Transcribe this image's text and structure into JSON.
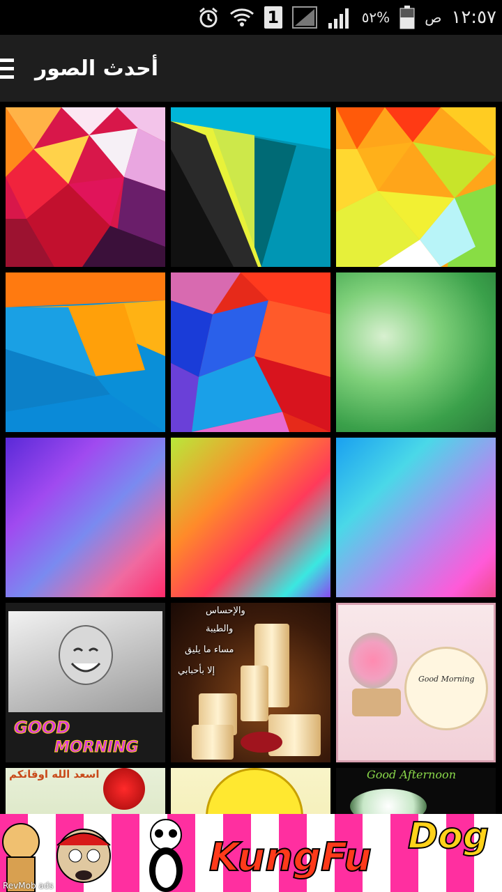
{
  "status_bar": {
    "time": "١٢:٥٧",
    "am_pm": "ص",
    "battery": "٥٢%",
    "sim": "1"
  },
  "app_bar": {
    "title": "أحدث الصور"
  },
  "tiles": [
    {
      "name": "poly-red-pink"
    },
    {
      "name": "material-yellow-teal"
    },
    {
      "name": "poly-orange-green"
    },
    {
      "name": "material-orange-blue"
    },
    {
      "name": "poly-blue-red"
    },
    {
      "name": "blur-green"
    },
    {
      "name": "blur-purple-pink"
    },
    {
      "name": "blur-green-orange"
    },
    {
      "name": "blur-blue-pink"
    },
    {
      "name": "good-morning-baby",
      "text1": "GOOD",
      "text2": "MORNING"
    },
    {
      "name": "candles-arabic",
      "lines": [
        "والإحساس",
        "والطيبة",
        "مساء ما يليق",
        "إلا بأحبابي"
      ]
    },
    {
      "name": "good-morning-clock",
      "text": "Good Morning"
    },
    {
      "name": "arabic-rose",
      "text": "اسعد الله اوقاتكم"
    },
    {
      "name": "yellow-smiley"
    },
    {
      "name": "good-afternoon",
      "text": "Good Afternoon"
    }
  ],
  "ad": {
    "title1": "KungFu",
    "title2": "Dog",
    "credit": "RevMob ads"
  }
}
